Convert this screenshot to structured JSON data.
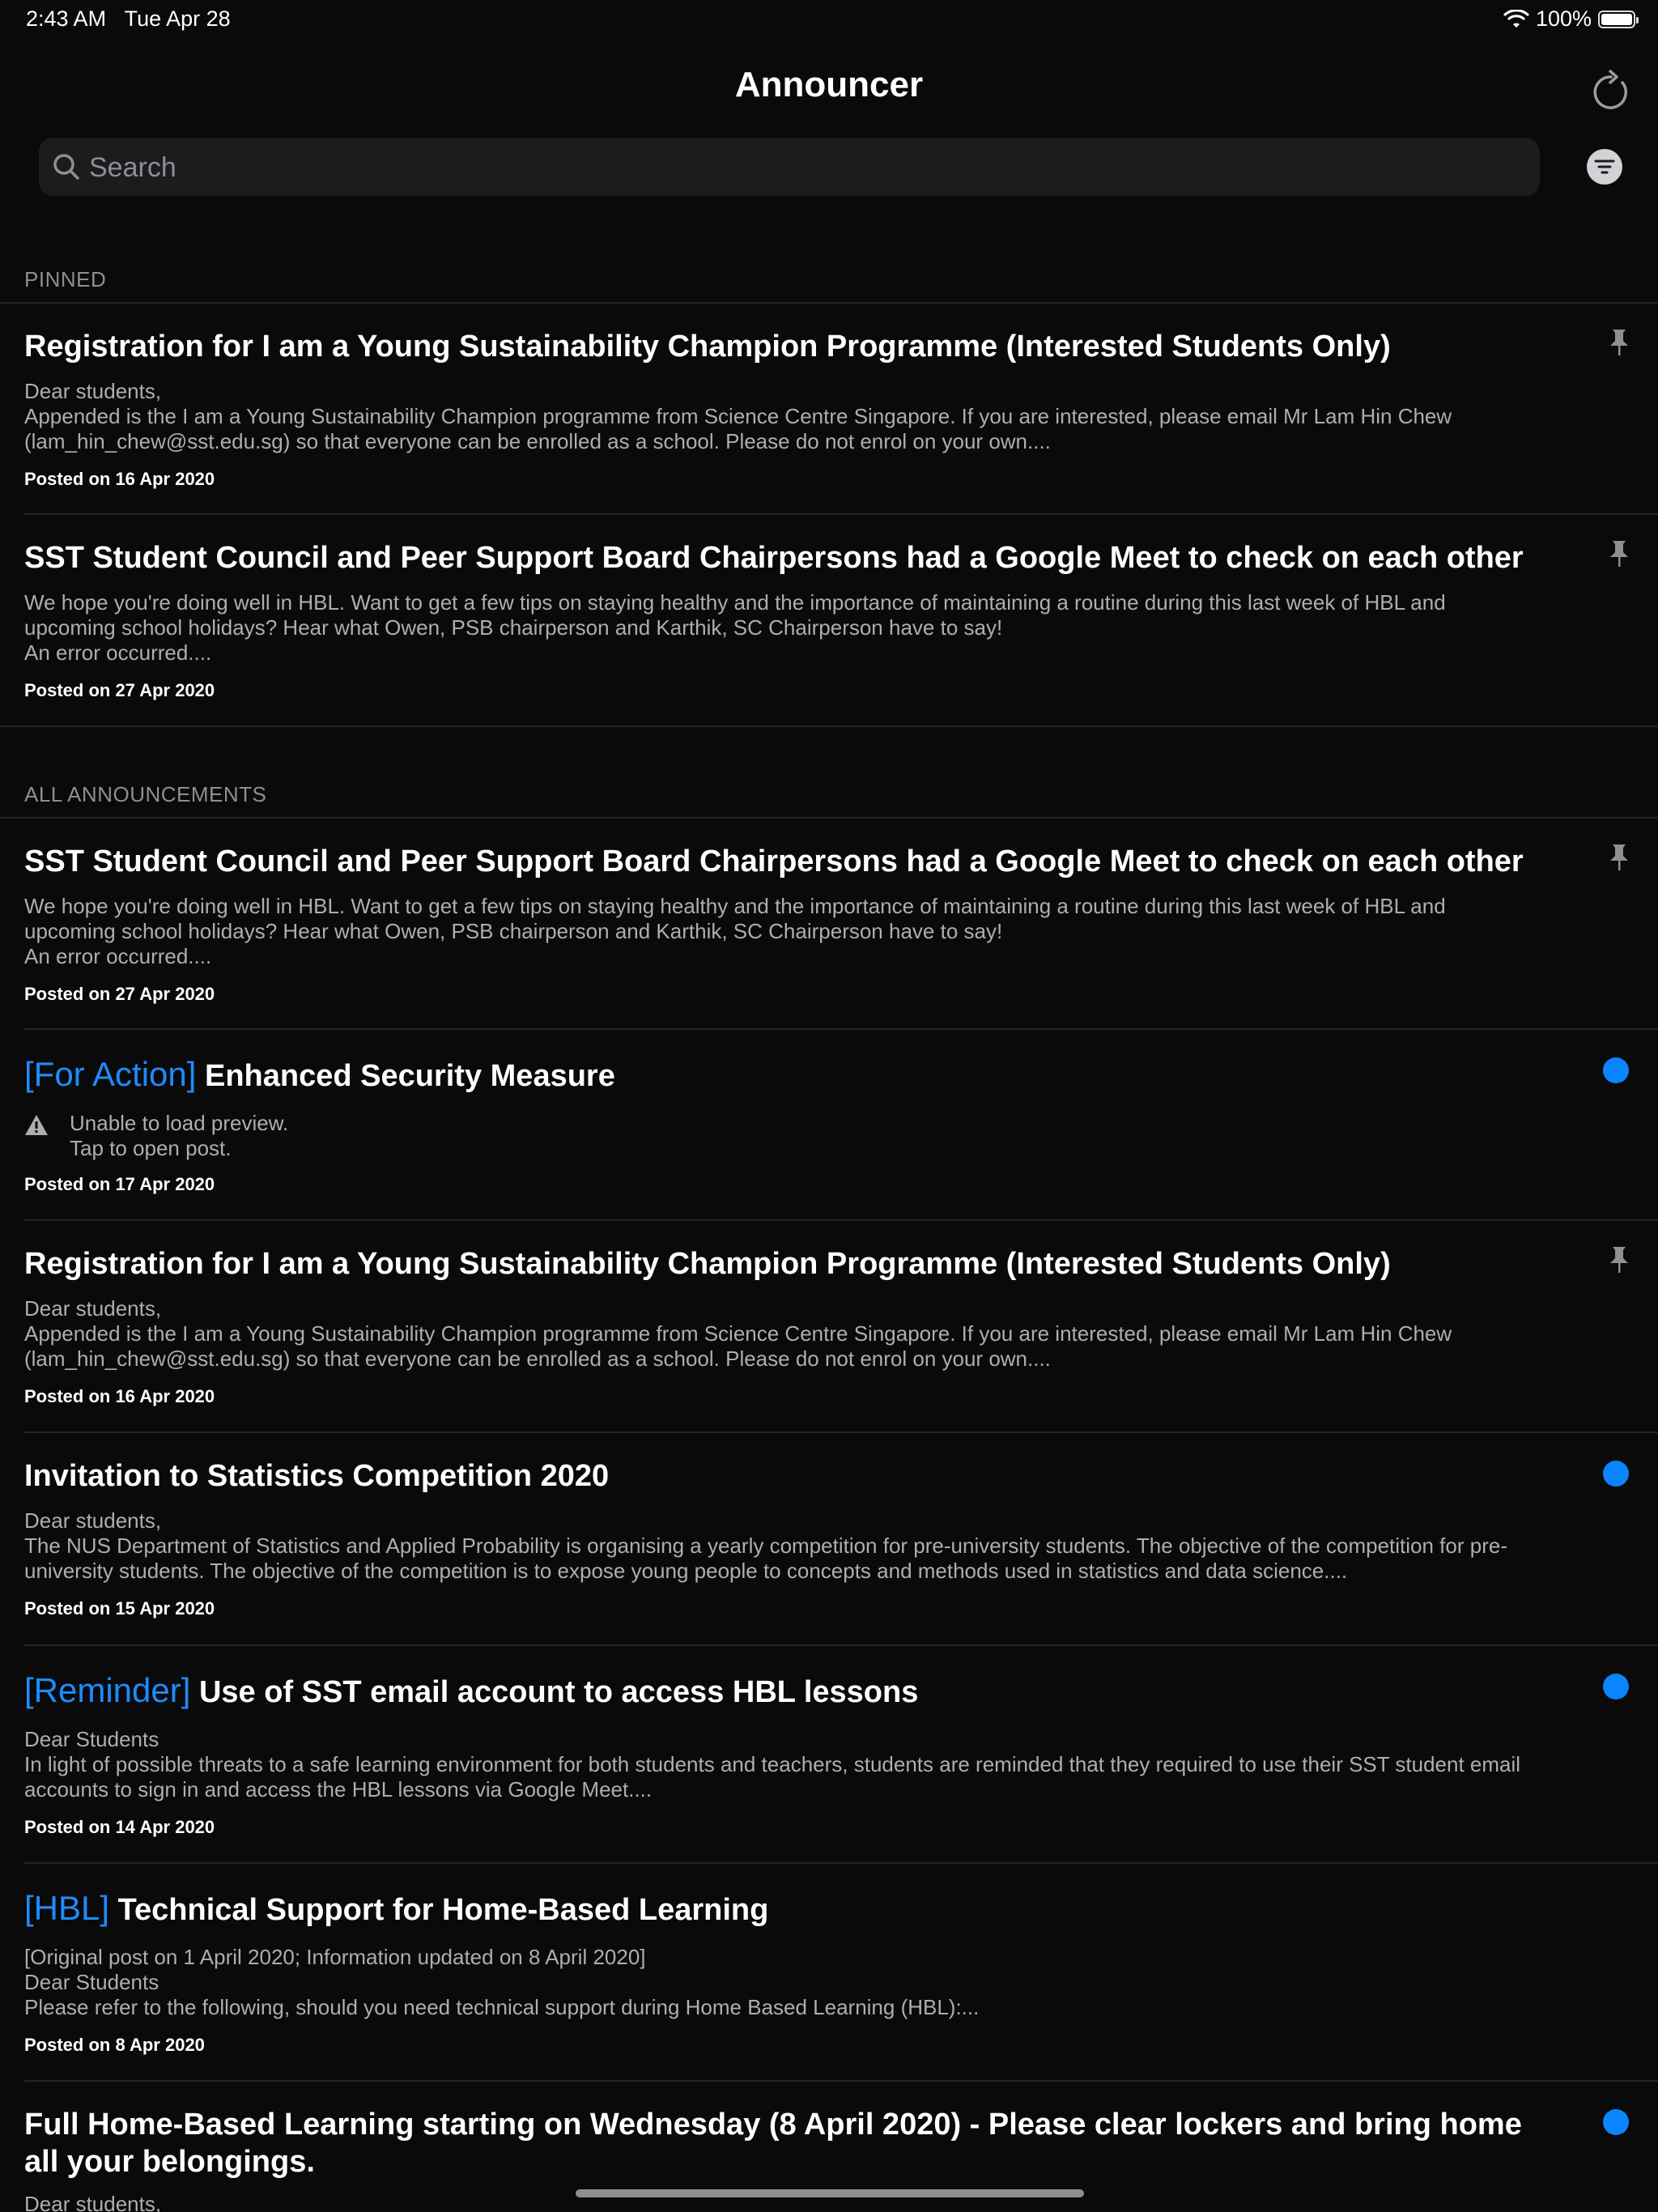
{
  "status": {
    "time": "2:43 AM",
    "date": "Tue Apr 28",
    "battery": "100%"
  },
  "nav": {
    "title": "Announcer"
  },
  "search": {
    "placeholder": "Search"
  },
  "sections": {
    "pinned": "PINNED",
    "all": "ALL ANNOUNCEMENTS"
  },
  "pinned": [
    {
      "title": "Registration for I am a Young Sustainability Champion Programme (Interested Students Only)",
      "body": "Dear students,\nAppended is the I am a Young Sustainability Champion programme from Science Centre Singapore. If you are interested, please email Mr Lam Hin Chew (lam_hin_chew@sst.edu.sg) so that everyone can be enrolled as a school. Please do not enrol on your own....",
      "date": "Posted on 16 Apr 2020"
    },
    {
      "title": "SST Student Council and Peer Support Board Chairpersons had a Google Meet to check on each other",
      "body": "We hope you're doing well in HBL. Want to get a few tips on staying healthy and the importance of maintaining a routine during this last week of HBL and upcoming school holidays? Hear what Owen, PSB chairperson and Karthik, SC Chairperson have to say!\nAn error occurred....",
      "date": "Posted on 27 Apr 2020"
    }
  ],
  "all": [
    {
      "title": "SST Student Council and Peer Support Board Chairpersons had a Google Meet to check on each other",
      "body": "We hope you're doing well in HBL. Want to get a few tips on staying healthy and the importance of maintaining a routine during this last week of HBL and upcoming school holidays? Hear what Owen, PSB chairperson and Karthik, SC Chairperson have to say!\nAn error occurred....",
      "date": "Posted on 27 Apr 2020"
    },
    {
      "tag": "[For Action]",
      "title": "Enhanced Security Measure",
      "body": "Unable to load preview.\nTap to open post.",
      "date": "Posted on 17 Apr 2020"
    },
    {
      "title": "Registration for I am a Young Sustainability Champion Programme (Interested Students Only)",
      "body": "Dear students,\nAppended is the I am a Young Sustainability Champion programme from Science Centre Singapore. If you are interested, please email Mr Lam Hin Chew (lam_hin_chew@sst.edu.sg) so that everyone can be enrolled as a school. Please do not enrol on your own....",
      "date": "Posted on 16 Apr 2020"
    },
    {
      "title": "Invitation to Statistics Competition 2020",
      "body": "Dear students,\nThe NUS Department of Statistics and Applied Probability is organising a yearly competition for pre-university students. The objective of the competition for pre-university students. The objective of the competition is to expose young people to concepts and methods used in statistics and data science....",
      "date": "Posted on 15 Apr 2020"
    },
    {
      "tag": "[Reminder]",
      "title": "Use of SST email account to access HBL lessons",
      "body": "Dear Students\nIn light of possible threats to a safe learning environment for both students and teachers, students are reminded that they required to use their SST student email accounts to sign in and access the HBL lessons via Google Meet....",
      "date": "Posted on 14 Apr 2020"
    },
    {
      "tag": "[HBL]",
      "title": "Technical Support for Home-Based Learning",
      "body": "[Original post on 1 April 2020; Information updated on 8 April 2020]\nDear Students\nPlease refer to the following, should you need technical support during Home Based Learning (HBL):...",
      "date": "Posted on 8 Apr 2020"
    },
    {
      "title": "Full Home-Based Learning starting on Wednesday (8 April 2020) - Please clear lockers and bring home all your belongings.",
      "body": "Dear students,"
    }
  ],
  "colors": {
    "accent": "#0a84ff",
    "tag": "#1e8bff",
    "background": "#0a0a0a"
  }
}
